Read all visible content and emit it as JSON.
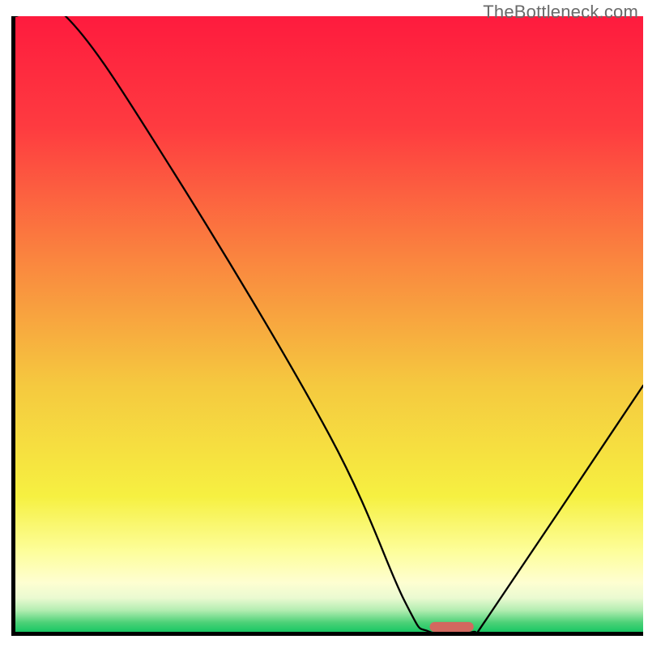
{
  "watermark": "TheBottleneck.com",
  "chart_data": {
    "type": "line",
    "title": "",
    "xlabel": "",
    "ylabel": "",
    "xlim": [
      0,
      100
    ],
    "ylim": [
      0,
      100
    ],
    "x": [
      0,
      8,
      25,
      50,
      62,
      66,
      73,
      75,
      100
    ],
    "values": [
      100,
      100,
      75,
      32,
      5,
      0,
      0,
      2,
      40
    ],
    "highlight": {
      "x_start": 66,
      "x_end": 73,
      "y": 0
    },
    "background": {
      "gradient_stops": [
        {
          "offset": 0.0,
          "color": "#fe1b3e"
        },
        {
          "offset": 0.18,
          "color": "#fe3b40"
        },
        {
          "offset": 0.4,
          "color": "#fa873f"
        },
        {
          "offset": 0.6,
          "color": "#f5c93f"
        },
        {
          "offset": 0.78,
          "color": "#f6f041"
        },
        {
          "offset": 0.87,
          "color": "#fdfe9b"
        },
        {
          "offset": 0.92,
          "color": "#fefed1"
        },
        {
          "offset": 0.945,
          "color": "#eafad1"
        },
        {
          "offset": 0.965,
          "color": "#b3edb1"
        },
        {
          "offset": 0.985,
          "color": "#4cd177"
        },
        {
          "offset": 1.0,
          "color": "#1ac764"
        }
      ]
    }
  }
}
